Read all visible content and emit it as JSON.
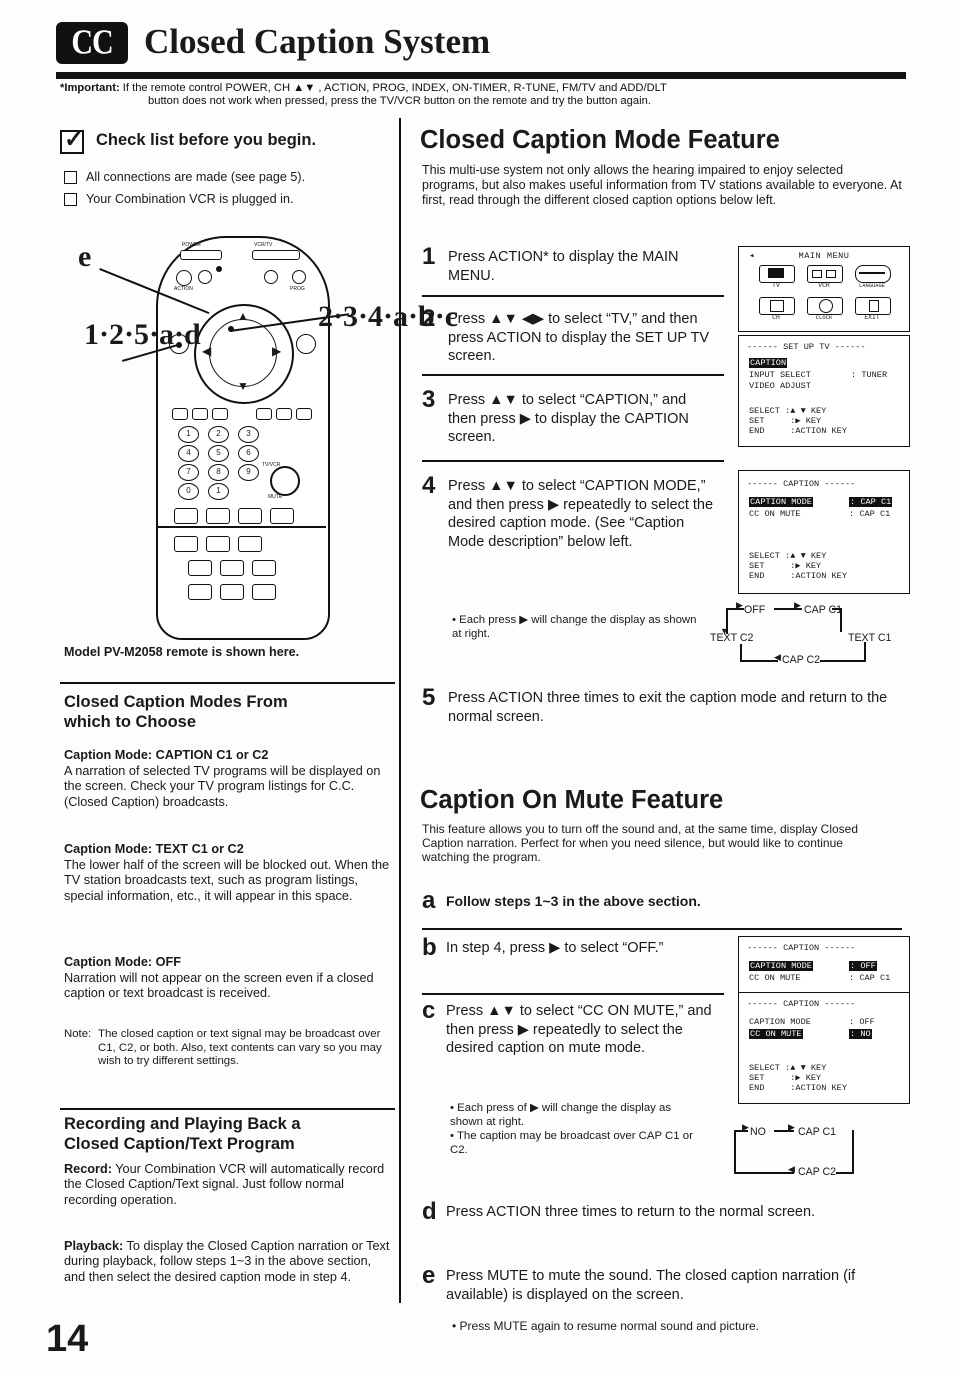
{
  "header": {
    "logo_text": "CC",
    "title": "Closed Caption System"
  },
  "important_note": {
    "label": "*Important:",
    "line1": "If the remote control POWER, CH ▲▼ , ACTION, PROG, INDEX, ON-TIMER, R-TUNE, FM/TV and ADD/DLT",
    "line2": "button does not work when pressed, press the TV/VCR button on the remote and try the button again."
  },
  "checklist": {
    "heading": "Check list before you begin.",
    "items": [
      "All connections are made (see page 5).",
      "Your Combination VCR is plugged in."
    ]
  },
  "remote": {
    "callout_e": "e",
    "callout_left": "1·2·5·a·d",
    "callout_right": "2·3·4·a·b·c",
    "caption": "Model PV-M2058 remote is shown here.",
    "labels": {
      "power": "POWER",
      "vcrtv": "VCR/TV",
      "action": "ACTION",
      "prog": "PROG",
      "mute": "MUTE",
      "tvvcr": "TV/VCR"
    }
  },
  "left": {
    "modes_heading": "Closed Caption Modes From\nwhich to Choose",
    "modes_heading_l1": "Closed Caption Modes From",
    "modes_heading_l2": "which to Choose",
    "mode_c1c2_title": "Caption Mode: CAPTION C1 or C2",
    "mode_c1c2_body": "A narration of selected TV programs will be displayed on the screen. Check your TV program listings for C.C. (Closed Caption) broadcasts.",
    "mode_text_title": "Caption Mode: TEXT C1 or C2",
    "mode_text_body": "The lower half of the screen will be blocked out. When the TV station broadcasts text, such as program listings, special information, etc., it will appear in this space.",
    "mode_off_title": "Caption Mode: OFF",
    "mode_off_body": "Narration will not appear on the screen even if a closed caption or text broadcast is received.",
    "note_label": "Note:",
    "note_body": "The closed caption or text signal may be broadcast over C1, C2, or both. Also, text contents can vary so you may wish to try different settings.",
    "rec_heading_l1": "Recording and Playing Back a",
    "rec_heading_l2": "Closed Caption/Text Program",
    "record_label": "Record:",
    "record_body": "Your Combination VCR will automatically record the Closed Caption/Text signal. Just follow normal recording operation.",
    "playback_label": "Playback:",
    "playback_body": "To display the Closed Caption narration or Text during playback, follow steps 1~3 in the above section, and then select the desired caption mode in step 4."
  },
  "right": {
    "mode_feature_title": "Closed Caption Mode Feature",
    "mode_feature_intro": "This multi-use system not only allows the hearing impaired to enjoy selected programs, but also makes useful information from TV stations available to everyone. At first, read through the different closed caption options below left.",
    "steps": [
      {
        "num": "1",
        "text": "Press ACTION* to display the MAIN MENU."
      },
      {
        "num": "2",
        "text": "Press ▲▼ ◀▶ to select “TV,” and then press ACTION to display the SET UP TV screen."
      },
      {
        "num": "3",
        "text": "Press ▲▼ to select “CAPTION,” and then press ▶ to display the CAPTION screen."
      },
      {
        "num": "4",
        "text": "Press ▲▼ to select “CAPTION MODE,” and then press ▶ repeatedly to select the desired caption mode. (See “Caption Mode description” below left."
      },
      {
        "num": "5",
        "text": "Press ACTION three times to exit the caption mode and return to the normal screen."
      }
    ],
    "step4_bullet": "• Each press ▶ will change the display as shown at right.",
    "mute_title": "Caption On Mute Feature",
    "mute_intro": "This feature allows you to turn off the sound and, at the same time, display Closed Caption narration. Perfect for when you need silence, but would like to continue watching the program.",
    "mute_steps": [
      {
        "num": "a",
        "text": "Follow steps 1~3 in the above section."
      },
      {
        "num": "b",
        "text": "In step 4, press ▶ to select “OFF.”"
      },
      {
        "num": "c",
        "text": "Press ▲▼ to select “CC ON MUTE,” and then press ▶ repeatedly to select the desired caption on mute mode."
      },
      {
        "num": "d",
        "text": "Press ACTION three times to return to the normal screen."
      },
      {
        "num": "e",
        "text": "Press MUTE to mute the sound. The closed caption narration (if available) is displayed on the screen."
      }
    ],
    "mute_bullet1": "• Each press of ▶ will change the display as shown at right.",
    "mute_bullet2": "• The caption may be broadcast over CAP C1 or C2.",
    "mute_bullet3": "• Press MUTE again to resume normal sound and picture."
  },
  "osd": {
    "main_menu": {
      "title": "MAIN MENU",
      "items": [
        "TV",
        "VCR",
        "LANGUAGE",
        "CH",
        "CLOCK",
        "EXIT"
      ]
    },
    "set_up_tv": {
      "title": "------ SET UP TV ------",
      "rows": [
        {
          "label": "CAPTION",
          "value": "",
          "selected": true
        },
        {
          "label": "INPUT SELECT",
          "value": ": TUNER",
          "selected": false
        },
        {
          "label": "VIDEO ADJUST",
          "value": "",
          "selected": false
        }
      ],
      "legend": [
        "SELECT :▲ ▼ KEY",
        "SET     :▶ KEY",
        "END     :ACTION KEY"
      ]
    },
    "caption1": {
      "title": "------ CAPTION ------",
      "rows": [
        {
          "label": "CAPTION MODE",
          "value": ": CAP C1",
          "selected": true
        },
        {
          "label": "CC ON MUTE",
          "value": ": CAP C1",
          "selected": false
        }
      ],
      "legend": [
        "SELECT :▲ ▼ KEY",
        "SET     :▶ KEY",
        "END     :ACTION KEY"
      ]
    },
    "caption2": {
      "title": "------ CAPTION ------",
      "rows": [
        {
          "label": "CAPTION MODE",
          "value": ": OFF",
          "selected": true
        },
        {
          "label": "CC ON MUTE",
          "value": ": CAP C1",
          "selected": false
        }
      ]
    },
    "caption3": {
      "title": "------ CAPTION ------",
      "rows": [
        {
          "label": "CAPTION MODE",
          "value": ": OFF",
          "selected": false
        },
        {
          "label": "CC ON MUTE",
          "value": ": NO",
          "selected": true
        }
      ],
      "legend": [
        "SELECT :▲ ▼ KEY",
        "SET     :▶ KEY",
        "END     :ACTION KEY"
      ]
    }
  },
  "flow1": {
    "nodes": [
      "OFF",
      "CAP C1",
      "TEXT C1",
      "CAP C2",
      "TEXT C2"
    ]
  },
  "flow2": {
    "nodes": [
      "NO",
      "CAP C1",
      "CAP C2"
    ]
  },
  "page_number": "14"
}
